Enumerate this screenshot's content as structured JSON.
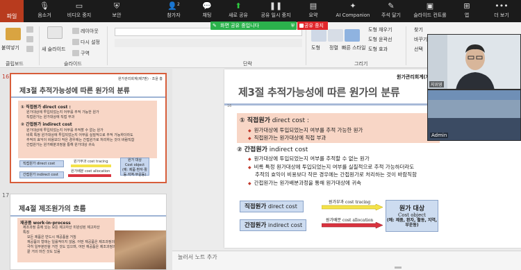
{
  "zoom": {
    "items": [
      {
        "label": "음소거",
        "icon": "mic-icon"
      },
      {
        "label": "비디오 중지",
        "icon": "video-icon"
      },
      {
        "label": "보안",
        "icon": "shield-icon"
      },
      {
        "label": "참가자",
        "icon": "participants-icon",
        "badge": "2"
      },
      {
        "label": "채팅",
        "icon": "chat-icon"
      },
      {
        "label": "새로 공유",
        "icon": "share-icon"
      },
      {
        "label": "공유 일시 중지",
        "icon": "pause-icon"
      },
      {
        "label": "요약",
        "icon": "summary-icon"
      },
      {
        "label": "AI Companion",
        "icon": "ai-icon"
      },
      {
        "label": "주석 달기",
        "icon": "annotate-icon"
      },
      {
        "label": "슬라이드 컨트롤",
        "icon": "slide-control-icon"
      },
      {
        "label": "앱",
        "icon": "apps-icon"
      },
      {
        "label": "더 보기",
        "icon": "more-icon"
      }
    ],
    "sharing_status": "화면 공유 중입니다",
    "stop_share": "공유 중지",
    "share_color": "#2bb24c",
    "stop_color": "#e0262b"
  },
  "ppt": {
    "file_tab": "파일",
    "ribbon": {
      "paste": "붙여넣기",
      "new_slide": "새 슬라이드",
      "layout": "레이아웃",
      "reset": "다시 설정",
      "section": "구역",
      "arrange": "정렬",
      "quick_styles": "빠른 스타일",
      "shape": "도형",
      "fill": "도형 채우기",
      "outline": "도형 윤곽선",
      "effects": "도형 효과",
      "find": "찾기",
      "replace": "바꾸기",
      "select": "선택",
      "groups": [
        "클립보드",
        "슬라이드",
        "단락",
        "그리기"
      ]
    },
    "thumbnails": [
      {
        "number": "16",
        "tag": "원가관리회계(제7판) · 조윤 홍",
        "title": "제3절 추적가능성에 따른 원가의 분류",
        "head1": "① 직접원가 direct cost :",
        "bul1": [
          "원가대상에 투입되었는지 어부를 추적 가능한 원가",
          "직접원가는 원가대상에 직접 부과"
        ],
        "head2": "② 간접원가 indirect cost",
        "bul2": [
          "원가대상에 투입되었는지 어부를 추적할 수 없는 원가",
          "비록 특정 원가대상에 투입되었는지 어부를 실질적으로 추적 가능하더라도",
          "추적의 효익이 비용보다 작은 경우에는 간접원가로 처리하는 것이 바람직함",
          "간접원가는 원가배분과정을 통해 원가대상 귀속"
        ],
        "pill1": "직접원가 direct cost",
        "pill2": "간접원가 indirect cost",
        "arrow1": "원가부과 cost tracing",
        "arrow2": "원가배분 cost allocation",
        "target": [
          "원가 대상",
          "Cost object",
          "(예: 제품·환자·활동·지역·부운동)"
        ]
      },
      {
        "number": "17",
        "title": "제4절 제조원가의 흐름",
        "lines": [
          "재공품 work-in-process",
          "제조과정 중에 있는 모든 제고자산 미완성된 제고자산",
          "특징",
          "모든 제품은 반드시 재공품을 거침",
          "재공품의 형태는 일률적이지 않음. 어떤 재공품은 제조과정의",
          "극히 일부분만을 거친 것도 있으며, 어떤 재공품은 제조과정의",
          "끝 거의 마친 것도 있음"
        ]
      }
    ],
    "slide": {
      "number": "16",
      "tag": "원가관리회계(제7판)",
      "title": "제3절 추적가능성에 따른 원가의 분류",
      "head1_ko": "① 직접원가",
      "head1_en": "direct cost :",
      "bul1": [
        "원가대상에 투입되었는지 여부를 추적 가능한 원가",
        "직접원가는 원가대상에 직접 부과"
      ],
      "head2_ko": "② 간접원가",
      "head2_en": "indirect cost",
      "bul2": [
        "원가대상에 투입되었는지 여부를 추적할 수 없는 원가",
        "비록 특정 원가대상에 투입되었는지 여부를 실질적으로 추적 가능하더라도",
        "추적의 효익이 비용보다 작은 경우에는 간접원가로 처리하는 것이 바람직함",
        "간접원가는 원가배분과정을 통해 원가대상에 귀속"
      ],
      "pill1_ko": "직접원가",
      "pill1_en": "direct cost",
      "pill2_ko": "간접원가",
      "pill2_en": "indirect cost",
      "arrow1": "원가부과 cost tracing",
      "arrow2": "원가배분 cost allocation",
      "target1": "원가 대상",
      "target2": "Cost object",
      "target3": "(예: 제품, 환자, 활동, 지역, 부운동)",
      "accent": "#f8d6c6",
      "pill_color": "#cddcf0"
    },
    "notes_placeholder": "눌러서 노트 추가"
  },
  "video": {
    "presenter_name": "지위영",
    "admin_name": "Admin"
  }
}
